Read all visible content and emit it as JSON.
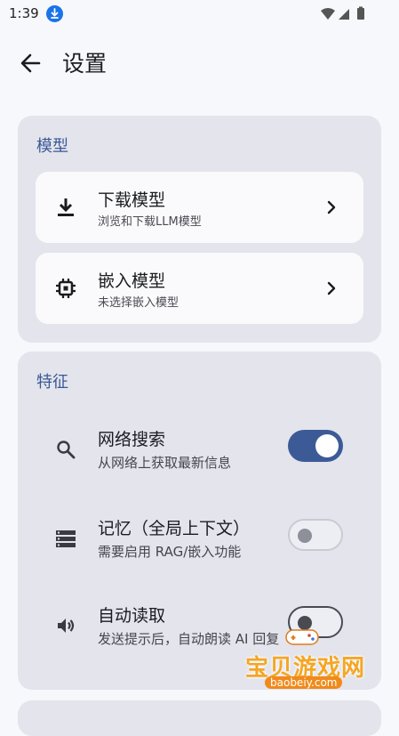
{
  "status_bar": {
    "time": "1:39"
  },
  "app_bar": {
    "title": "设置"
  },
  "sections": {
    "model": {
      "title": "模型",
      "items": [
        {
          "title": "下载模型",
          "subtitle": "浏览和下载LLM模型",
          "icon": "download-icon"
        },
        {
          "title": "嵌入模型",
          "subtitle": "未选择嵌入模型",
          "icon": "chip-icon"
        }
      ]
    },
    "features": {
      "title": "特征",
      "items": [
        {
          "title": "网络搜索",
          "subtitle": "从网络上获取最新信息",
          "icon": "search-icon",
          "enabled": true
        },
        {
          "title": "记忆（全局上下文）",
          "subtitle": "需要启用 RAG/嵌入功能",
          "icon": "storage-icon",
          "enabled": false
        },
        {
          "title": "自动读取",
          "subtitle": "发送提示后，自动朗读 AI 回复",
          "icon": "speaker-icon",
          "enabled": false
        }
      ]
    }
  },
  "watermark": {
    "text": "宝贝游戏网",
    "url": "baobeiy.com"
  },
  "colors": {
    "accent": "#3c5a96",
    "section_bg": "#e3e4ec",
    "card_bg": "#fafafd",
    "page_bg": "#f7f8fc"
  }
}
